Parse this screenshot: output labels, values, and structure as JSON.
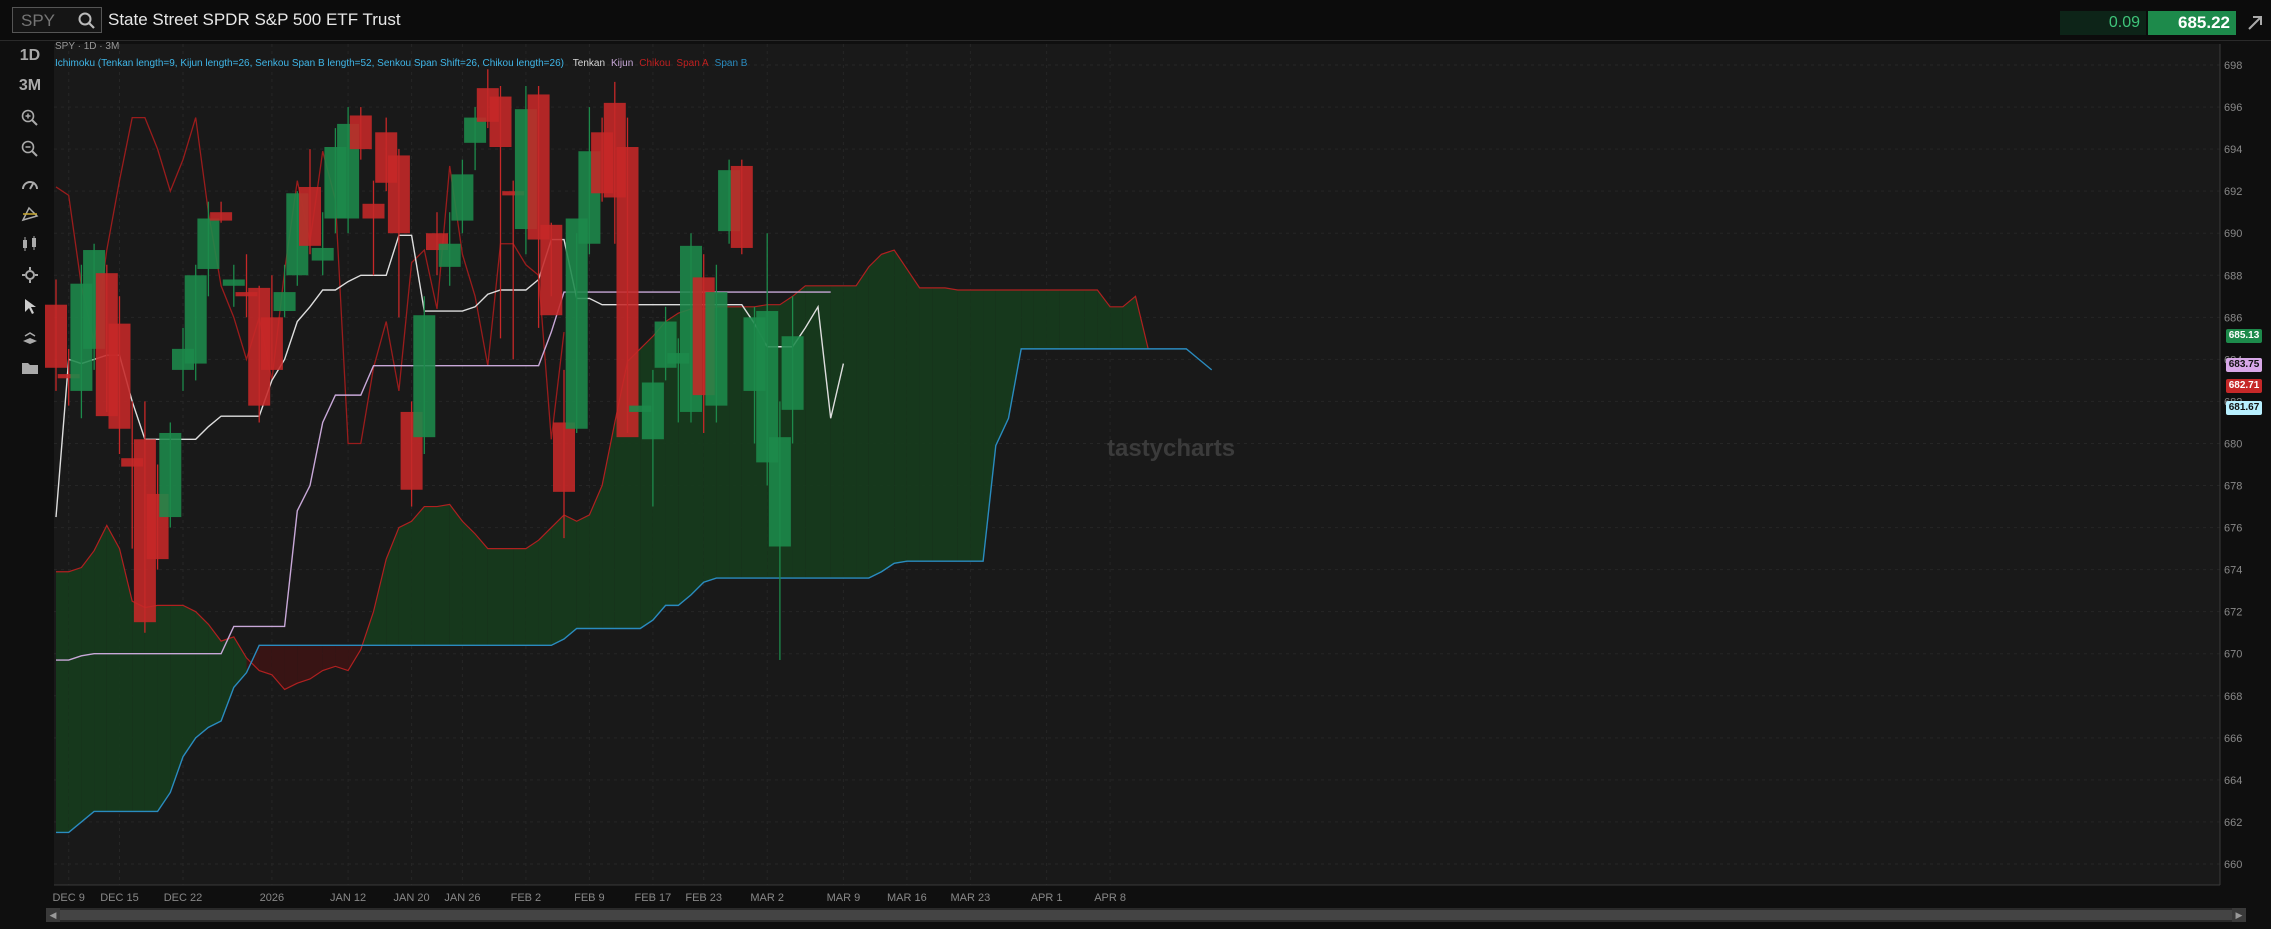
{
  "toolbar": {
    "symbol_placeholder": "SPY",
    "instrument_name": "State Street SPDR S&P 500 ETF Trust",
    "change": "0.09",
    "last_price": "685.22"
  },
  "sidebar": {
    "aggregation_label": "1D",
    "range_label": "3M"
  },
  "chart_header": "SPY · 1D · 3M",
  "study": {
    "prefix": "Ichimoku (Tenkan length=9, Kijun length=26, Senkou Span B length=52, Senkou Span Shift=26, Chikou length=26)",
    "legend": [
      {
        "label": "Tenkan",
        "color": "#d8d8d8"
      },
      {
        "label": "Kijun",
        "color": "#c8a8d8"
      },
      {
        "label": "Chikou",
        "color": "#c02020"
      },
      {
        "label": "Span A",
        "color": "#c02020"
      },
      {
        "label": "Span B",
        "color": "#2a8bbf"
      }
    ]
  },
  "watermark": "tastycharts",
  "price_tags": [
    {
      "value": "685.13",
      "bg": "#1d8a4b",
      "fg": "#ffffff"
    },
    {
      "value": "683.75",
      "bg": "#d8a8e8",
      "fg": "#111111"
    },
    {
      "value": "682.71",
      "bg": "#c62828",
      "fg": "#ffffff"
    },
    {
      "value": "681.67",
      "bg": "#b8f0ff",
      "fg": "#111111"
    }
  ],
  "colors": {
    "up": "#1d8a4b",
    "down": "#c62828",
    "cloud_bull": "#163a1c",
    "cloud_bear": "#3a1414"
  },
  "chart_data": {
    "type": "candlestick",
    "ylim": [
      659,
      699
    ],
    "y_ticks": [
      660,
      662,
      664,
      666,
      668,
      670,
      672,
      674,
      676,
      678,
      680,
      682,
      684,
      686,
      688,
      690,
      692,
      694,
      696,
      698
    ],
    "x_labels": [
      {
        "i": 1,
        "label": "DEC 9"
      },
      {
        "i": 5,
        "label": "DEC 15"
      },
      {
        "i": 10,
        "label": "DEC 22"
      },
      {
        "i": 17,
        "label": "2026"
      },
      {
        "i": 23,
        "label": "JAN 12"
      },
      {
        "i": 28,
        "label": "JAN 20"
      },
      {
        "i": 32,
        "label": "JAN 26"
      },
      {
        "i": 37,
        "label": "FEB 2"
      },
      {
        "i": 42,
        "label": "FEB 9"
      },
      {
        "i": 47,
        "label": "FEB 17"
      },
      {
        "i": 51,
        "label": "FEB 23"
      },
      {
        "i": 56,
        "label": "MAR 2"
      },
      {
        "i": 62,
        "label": "MAR 9"
      },
      {
        "i": 67,
        "label": "MAR 16"
      },
      {
        "i": 72,
        "label": "MAR 23"
      },
      {
        "i": 78,
        "label": "APR 1"
      },
      {
        "i": 83,
        "label": "APR 8"
      }
    ],
    "candles": [
      {
        "o": 686.6,
        "h": 687.8,
        "l": 682.5,
        "c": 683.6
      },
      {
        "o": 683.3,
        "h": 684.5,
        "l": 681.8,
        "c": 683.1
      },
      {
        "o": 682.5,
        "h": 688.5,
        "l": 681.2,
        "c": 687.6
      },
      {
        "o": 684.5,
        "h": 689.5,
        "l": 683.5,
        "c": 689.2
      },
      {
        "o": 688.1,
        "h": 688.5,
        "l": 681.5,
        "c": 681.3
      },
      {
        "o": 685.7,
        "h": 687.0,
        "l": 679.5,
        "c": 680.7
      },
      {
        "o": 679.3,
        "h": 682.0,
        "l": 675.0,
        "c": 678.9
      },
      {
        "o": 680.2,
        "h": 682.0,
        "l": 671.0,
        "c": 671.5
      },
      {
        "o": 677.6,
        "h": 679.0,
        "l": 674.0,
        "c": 674.5
      },
      {
        "o": 676.5,
        "h": 681.0,
        "l": 676.0,
        "c": 680.5
      },
      {
        "o": 683.5,
        "h": 685.5,
        "l": 682.5,
        "c": 684.5
      },
      {
        "o": 683.8,
        "h": 688.5,
        "l": 683.0,
        "c": 688.0
      },
      {
        "o": 688.3,
        "h": 691.5,
        "l": 687.0,
        "c": 690.7
      },
      {
        "o": 691.0,
        "h": 691.5,
        "l": 690.5,
        "c": 690.6
      },
      {
        "o": 687.5,
        "h": 688.5,
        "l": 686.5,
        "c": 687.8
      },
      {
        "o": 687.2,
        "h": 689.0,
        "l": 686.0,
        "c": 687.0
      },
      {
        "o": 687.4,
        "h": 687.5,
        "l": 681.0,
        "c": 681.8
      },
      {
        "o": 686.0,
        "h": 688.0,
        "l": 683.5,
        "c": 683.5
      },
      {
        "o": 686.3,
        "h": 688.5,
        "l": 686.0,
        "c": 687.2
      },
      {
        "o": 688.0,
        "h": 692.0,
        "l": 687.5,
        "c": 691.9
      },
      {
        "o": 692.2,
        "h": 694.0,
        "l": 689.0,
        "c": 689.4
      },
      {
        "o": 688.7,
        "h": 691.0,
        "l": 688.0,
        "c": 689.3
      },
      {
        "o": 690.7,
        "h": 695.0,
        "l": 690.0,
        "c": 694.1
      },
      {
        "o": 690.7,
        "h": 696.0,
        "l": 690.0,
        "c": 695.2
      },
      {
        "o": 695.6,
        "h": 696.0,
        "l": 693.5,
        "c": 694.0
      },
      {
        "o": 691.4,
        "h": 692.5,
        "l": 688.0,
        "c": 690.7
      },
      {
        "o": 694.8,
        "h": 695.5,
        "l": 692.0,
        "c": 692.4
      },
      {
        "o": 693.7,
        "h": 694.0,
        "l": 686.0,
        "c": 690.0
      },
      {
        "o": 681.5,
        "h": 682.0,
        "l": 677.0,
        "c": 677.8
      },
      {
        "o": 680.3,
        "h": 687.0,
        "l": 679.5,
        "c": 686.1
      },
      {
        "o": 690.0,
        "h": 691.0,
        "l": 688.0,
        "c": 689.2
      },
      {
        "o": 688.4,
        "h": 691.0,
        "l": 687.5,
        "c": 689.5
      },
      {
        "o": 690.6,
        "h": 693.5,
        "l": 690.0,
        "c": 692.8
      },
      {
        "o": 694.3,
        "h": 696.0,
        "l": 693.0,
        "c": 695.5
      },
      {
        "o": 696.9,
        "h": 697.8,
        "l": 695.0,
        "c": 695.3
      },
      {
        "o": 696.5,
        "h": 697.0,
        "l": 685.0,
        "c": 694.1
      },
      {
        "o": 692.0,
        "h": 692.5,
        "l": 684.0,
        "c": 691.8
      },
      {
        "o": 690.2,
        "h": 697.0,
        "l": 689.0,
        "c": 695.9
      },
      {
        "o": 696.6,
        "h": 697.0,
        "l": 685.5,
        "c": 689.7
      },
      {
        "o": 690.4,
        "h": 690.5,
        "l": 687.0,
        "c": 686.1
      },
      {
        "o": 681.0,
        "h": 683.5,
        "l": 675.5,
        "c": 677.7
      },
      {
        "o": 680.7,
        "h": 690.0,
        "l": 680.5,
        "c": 690.7
      },
      {
        "o": 689.5,
        "h": 696.0,
        "l": 689.0,
        "c": 693.9
      },
      {
        "o": 694.8,
        "h": 695.5,
        "l": 691.5,
        "c": 691.9
      },
      {
        "o": 696.2,
        "h": 697.2,
        "l": 689.5,
        "c": 691.7
      },
      {
        "o": 694.1,
        "h": 695.5,
        "l": 680.5,
        "c": 680.3
      },
      {
        "o": 681.5,
        "h": 681.5,
        "l": 681.5,
        "c": 681.8
      },
      {
        "o": 680.2,
        "h": 683.5,
        "l": 677.0,
        "c": 682.9
      },
      {
        "o": 683.6,
        "h": 686.5,
        "l": 683.0,
        "c": 685.8
      },
      {
        "o": 683.8,
        "h": 685.0,
        "l": 681.0,
        "c": 684.3
      },
      {
        "o": 681.5,
        "h": 690.0,
        "l": 681.0,
        "c": 689.4
      },
      {
        "o": 687.9,
        "h": 689.0,
        "l": 680.5,
        "c": 682.3
      },
      {
        "o": 681.8,
        "h": 688.5,
        "l": 681.0,
        "c": 687.2
      },
      {
        "o": 690.1,
        "h": 693.5,
        "l": 689.5,
        "c": 693.0
      },
      {
        "o": 693.2,
        "h": 693.5,
        "l": 689.0,
        "c": 689.3
      },
      {
        "o": 682.5,
        "h": 686.5,
        "l": 680.0,
        "c": 686.0
      },
      {
        "o": 679.1,
        "h": 690.0,
        "l": 678.0,
        "c": 686.3
      },
      {
        "o": 675.1,
        "h": 682.0,
        "l": 669.7,
        "c": 680.3
      },
      {
        "o": 681.6,
        "h": 687.0,
        "l": 680.0,
        "c": 685.1
      }
    ],
    "tenkan": [
      676.5,
      684.0,
      683.8,
      684.0,
      684.2,
      684.2,
      682.0,
      680.2,
      680.2,
      680.2,
      680.2,
      680.2,
      680.8,
      681.3,
      681.3,
      681.3,
      681.3,
      683.0,
      684.0,
      685.8,
      686.5,
      687.3,
      687.3,
      687.7,
      688.0,
      688.0,
      688.0,
      689.9,
      689.9,
      686.3,
      686.3,
      686.3,
      686.3,
      686.5,
      687.1,
      687.3,
      687.3,
      687.3,
      687.8,
      689.7,
      689.7,
      686.9,
      686.9,
      686.6,
      686.6,
      686.6,
      686.6,
      686.6,
      686.6,
      686.6,
      686.6,
      686.6,
      686.6,
      686.6,
      686.6,
      685.7,
      684.6,
      684.6,
      684.6,
      685.5,
      686.5,
      681.2,
      683.8
    ],
    "kijun": [
      669.7,
      669.7,
      669.9,
      670.0,
      670.0,
      670.0,
      670.0,
      670.0,
      670.0,
      670.0,
      670.0,
      670.0,
      670.0,
      670.0,
      671.3,
      671.3,
      671.3,
      671.3,
      671.3,
      676.8,
      678.0,
      681.0,
      682.3,
      682.3,
      682.3,
      683.7,
      683.7,
      683.7,
      683.7,
      683.7,
      683.7,
      683.7,
      683.7,
      683.7,
      683.7,
      683.7,
      683.7,
      683.7,
      683.7,
      685.3,
      687.2,
      687.2,
      687.2,
      687.2,
      687.2,
      687.2,
      687.2,
      687.2,
      687.2,
      687.2,
      687.2,
      687.2,
      687.2,
      687.2,
      687.2,
      687.2,
      687.2,
      687.2,
      687.2,
      687.2,
      687.2,
      687.2
    ],
    "chikou": [
      692.2,
      691.8,
      687.5,
      684.8,
      689.2,
      692.5,
      695.5,
      695.5,
      694.0,
      692.0,
      693.5,
      695.5,
      691.0,
      687.5,
      686.0,
      684.0,
      686.0,
      683.0,
      688.2,
      692.5,
      689.6,
      693.9,
      691.6,
      680.0,
      680.0,
      683.6,
      685.8,
      682.5,
      688.6,
      689.2,
      686.4,
      693.2,
      689.0,
      687.0,
      683.7,
      689.5,
      689.5,
      688.5,
      688.0,
      680.2,
      685.3
    ],
    "span_a": [
      673.9,
      673.9,
      674.1,
      674.9,
      676.1,
      675.0,
      672.5,
      672.2,
      672.3,
      672.3,
      672.3,
      672.0,
      671.4,
      670.6,
      670.8,
      669.8,
      669.2,
      669.0,
      668.3,
      668.6,
      668.8,
      669.2,
      669.4,
      669.2,
      670.2,
      672.0,
      674.5,
      676.0,
      676.3,
      677.0,
      677.0,
      677.1,
      676.3,
      675.7,
      675.0,
      675.0,
      675.0,
      675.0,
      675.4,
      676.0,
      676.6,
      676.3,
      676.6,
      678.0,
      681.0,
      683.9,
      684.5,
      685.1,
      685.8,
      686.2,
      686.4,
      686.4,
      686.5,
      686.5,
      686.5,
      686.5,
      686.6,
      686.6,
      687.0,
      687.5,
      687.5,
      687.5,
      687.5,
      687.5,
      688.4,
      689.0,
      689.2,
      688.3,
      687.4,
      687.4,
      687.4,
      687.3,
      687.3,
      687.3,
      687.3,
      687.3,
      687.3,
      687.3,
      687.3,
      687.3,
      687.3,
      687.3,
      687.3,
      686.5,
      686.5,
      687.0,
      684.5
    ],
    "span_b": [
      661.5,
      661.5,
      662.0,
      662.5,
      662.5,
      662.5,
      662.5,
      662.5,
      662.5,
      663.4,
      665.1,
      666.0,
      666.5,
      666.8,
      668.4,
      669.1,
      670.4,
      670.4,
      670.4,
      670.4,
      670.4,
      670.4,
      670.4,
      670.4,
      670.4,
      670.4,
      670.4,
      670.4,
      670.4,
      670.4,
      670.4,
      670.4,
      670.4,
      670.4,
      670.4,
      670.4,
      670.4,
      670.4,
      670.4,
      670.4,
      670.7,
      671.2,
      671.2,
      671.2,
      671.2,
      671.2,
      671.2,
      671.6,
      672.3,
      672.3,
      672.8,
      673.4,
      673.6,
      673.6,
      673.6,
      673.6,
      673.6,
      673.6,
      673.6,
      673.6,
      673.6,
      673.6,
      673.6,
      673.6,
      673.6,
      673.9,
      674.3,
      674.4,
      674.4,
      674.4,
      674.4,
      674.4,
      674.4,
      674.4,
      679.9,
      681.2,
      684.5,
      684.5,
      684.5,
      684.5,
      684.5,
      684.5,
      684.5,
      684.5,
      684.5,
      684.5,
      684.5,
      684.5,
      684.5,
      684.5,
      684.0,
      683.5
    ]
  }
}
